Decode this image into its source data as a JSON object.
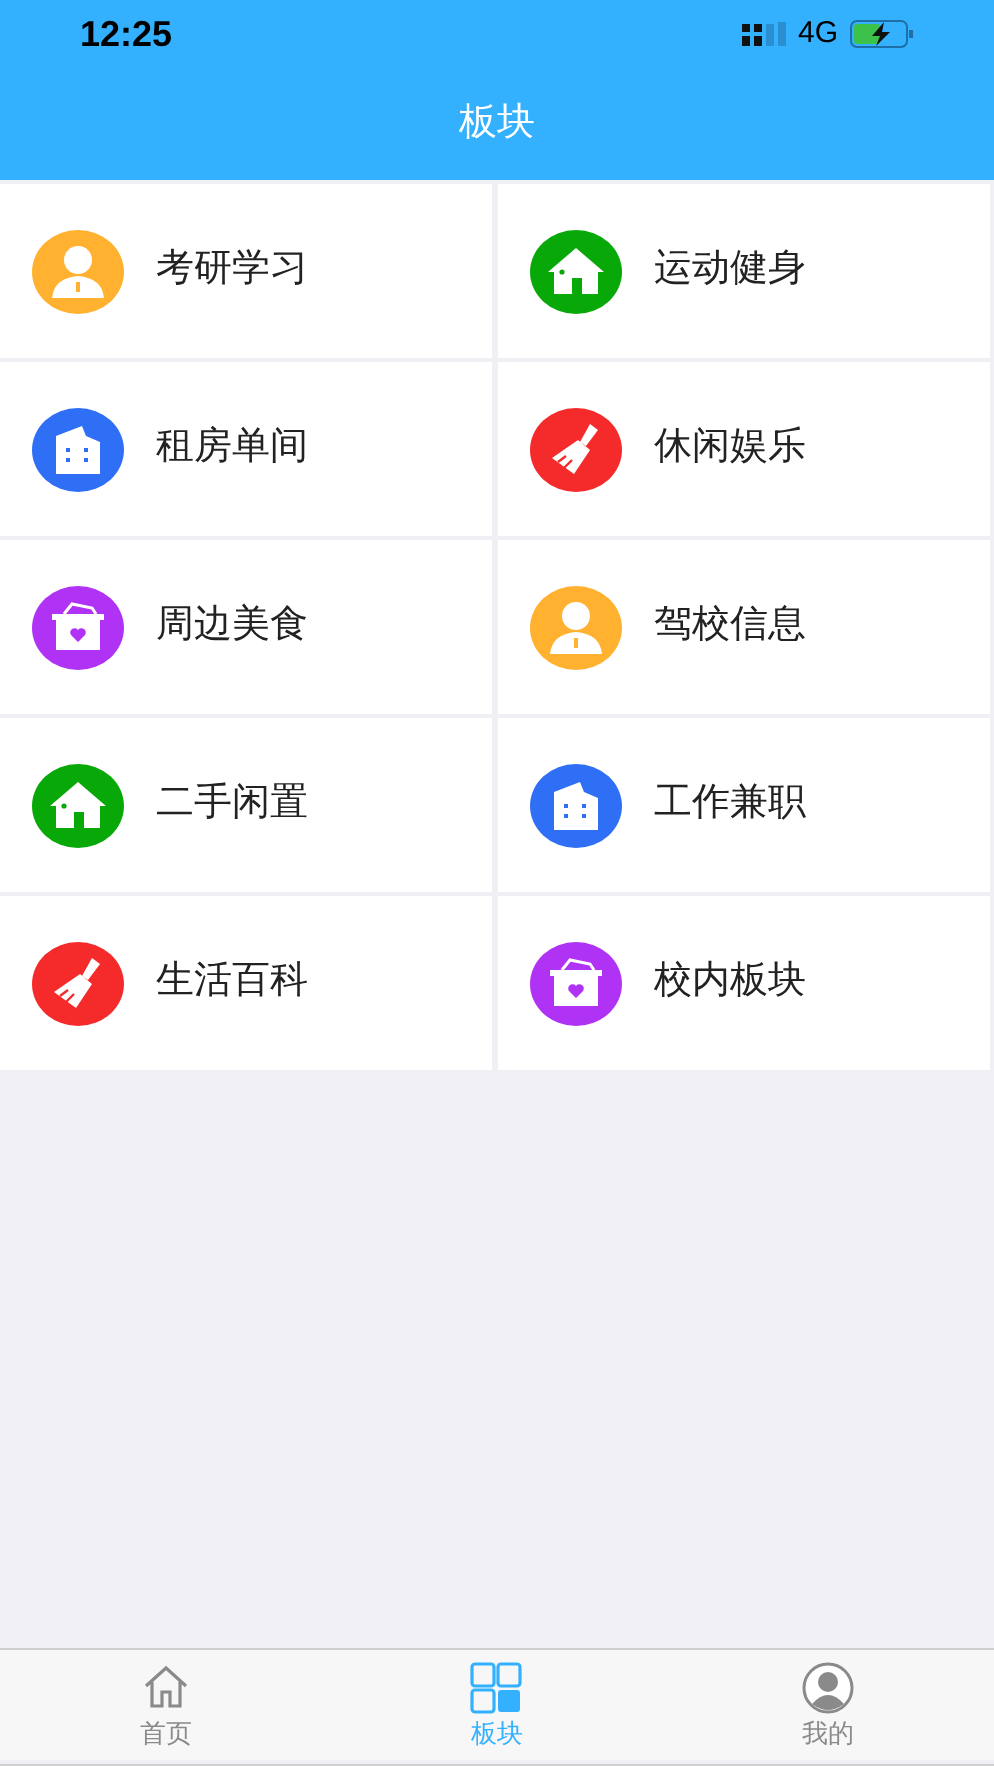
{
  "status_bar": {
    "time": "12:25",
    "network": "4G"
  },
  "header": {
    "title": "板块"
  },
  "boards": [
    {
      "label": "考研学习",
      "kind": "person",
      "color": "#ffb12f"
    },
    {
      "label": "运动健身",
      "kind": "house",
      "color": "#08a808"
    },
    {
      "label": "租房单间",
      "kind": "building",
      "color": "#2f6ff5"
    },
    {
      "label": "休闲娱乐",
      "kind": "broom",
      "color": "#f52a2a"
    },
    {
      "label": "周边美食",
      "kind": "basket",
      "color": "#b033f5"
    },
    {
      "label": "驾校信息",
      "kind": "person",
      "color": "#ffb12f"
    },
    {
      "label": "二手闲置",
      "kind": "house",
      "color": "#08a808"
    },
    {
      "label": "工作兼职",
      "kind": "building",
      "color": "#2f6ff5"
    },
    {
      "label": "生活百科",
      "kind": "broom",
      "color": "#f52a2a"
    },
    {
      "label": "校内板块",
      "kind": "basket",
      "color": "#b033f5"
    }
  ],
  "tab_bar": [
    {
      "label": "首页",
      "kind": "home",
      "selected": false
    },
    {
      "label": "板块",
      "kind": "grid",
      "selected": true
    },
    {
      "label": "我的",
      "kind": "profile",
      "selected": false
    }
  ]
}
